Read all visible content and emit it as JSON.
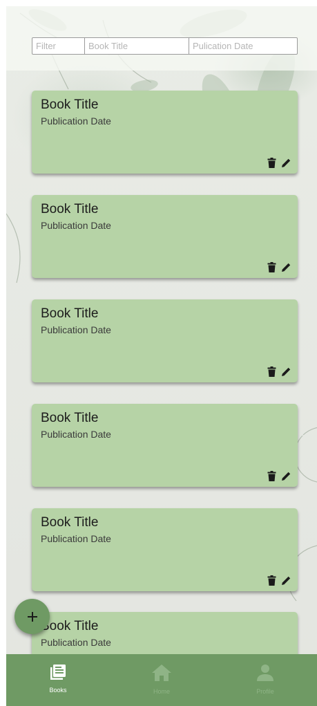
{
  "filters": {
    "filter_placeholder": "Filter",
    "title_placeholder": "Book Title",
    "date_placeholder": "Pulication Date"
  },
  "books": [
    {
      "title": "Book Title",
      "date": "Publication Date"
    },
    {
      "title": "Book Title",
      "date": "Publication Date"
    },
    {
      "title": "Book Title",
      "date": "Publication Date"
    },
    {
      "title": "Book Title",
      "date": "Publication Date"
    },
    {
      "title": "Book Title",
      "date": "Publication Date"
    },
    {
      "title": "Book Title",
      "date": "Publication Date"
    }
  ],
  "fab": {
    "label": "+",
    "icon": "plus-icon"
  },
  "nav": {
    "active": "Books",
    "items": [
      {
        "label": "Books",
        "icon": "books-icon"
      },
      {
        "label": "Home",
        "icon": "home-icon"
      },
      {
        "label": "Profile",
        "icon": "person-icon"
      }
    ]
  },
  "colors": {
    "card": "#b6d3a6",
    "nav_bar": "#6f9a64",
    "fab": "#6f9a64",
    "nav_inactive": "#8fb486"
  }
}
